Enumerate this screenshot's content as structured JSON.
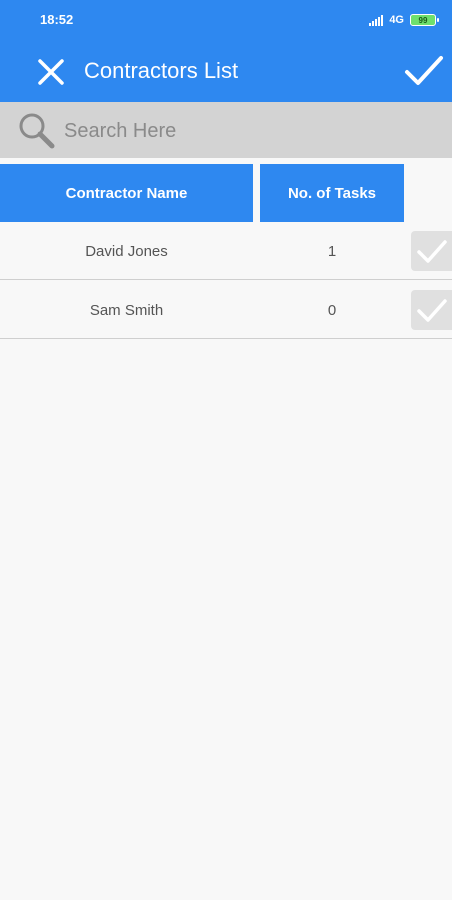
{
  "status_bar": {
    "time": "18:52",
    "network": "4G",
    "battery": "99"
  },
  "app_bar": {
    "title": "Contractors List",
    "close_icon": "close-icon",
    "confirm_icon": "checkmark-icon"
  },
  "search": {
    "placeholder": "Search Here",
    "value": "",
    "icon": "search-icon"
  },
  "table": {
    "columns": [
      "Contractor Name",
      "No. of Tasks"
    ],
    "rows": [
      {
        "name": "David Jones",
        "tasks": "1",
        "selected": false
      },
      {
        "name": "Sam Smith",
        "tasks": "0",
        "selected": false
      }
    ]
  },
  "colors": {
    "primary": "#2e88f0",
    "search_bg": "#d3d3d3",
    "checkbox_bg": "#e0e0e0",
    "background": "#f8f8f8"
  }
}
